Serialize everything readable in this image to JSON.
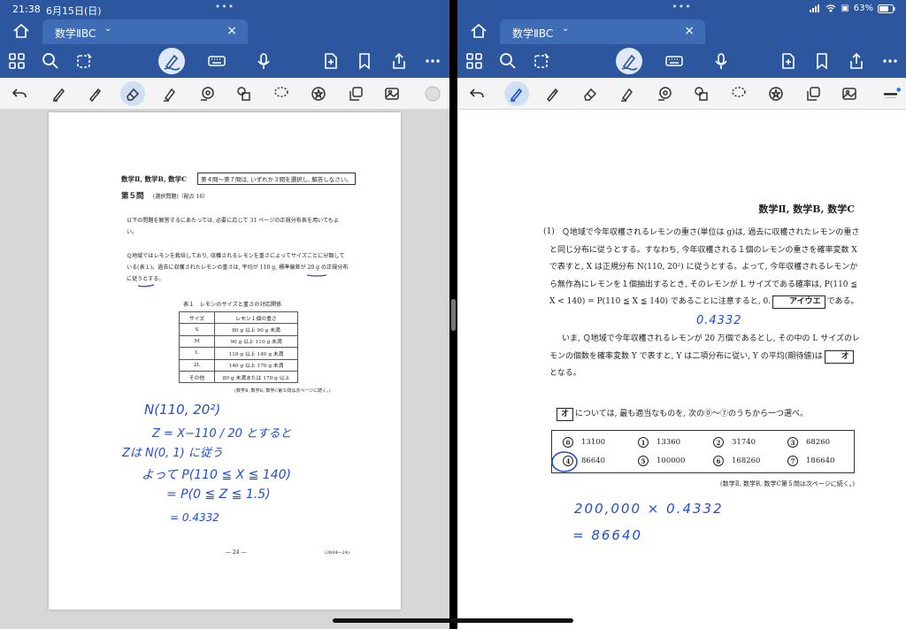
{
  "status": {
    "time": "21:38",
    "date": "6月15日(日)",
    "battery": "63%"
  },
  "tab": {
    "title": "数学ⅡBC"
  },
  "left_page": {
    "header": "数学Ⅱ, 数学B, 数学C",
    "header_box": "第４問～第７問は, いずれか３問を選択し, 解答しなさい。",
    "question_title": "第５問",
    "question_sub": "(選択問題)（配点 16）",
    "intro": "以下の問題を解答するにあたっては, 必要に応じて 31 ページの正規分布表を用いてもよい。",
    "body": "Ｑ地域ではレモンを栽培しており, 収穫されるレモンを重さによってサイズごとに分類している(表１)。過去に収穫されたレモンの重さは, 平均が 110 g, 標準偏差が 20 g の正規分布に従うとする。",
    "table_caption": "表１　レモンのサイズと重さの対応関係",
    "table": {
      "headers": [
        "サイズ",
        "レモン１個の重さ"
      ],
      "rows": [
        [
          "S",
          "80 g 以上 90 g 未満"
        ],
        [
          "M",
          "90 g 以上 110 g 未満"
        ],
        [
          "L",
          "110 g 以上 140 g 未満"
        ],
        [
          "2L",
          "140 g 以上 170 g 未満"
        ],
        [
          "その他",
          "80 g 未満または 170 g 以上"
        ]
      ]
    },
    "continued": "(数学Ⅱ, 数学B, 数学C第５問は次ページに続く。)",
    "page_number": "― 24 ―",
    "code": "(2604―24)"
  },
  "right_page": {
    "header": "数学Ⅱ, 数学B, 数学C",
    "q_number": "(1)",
    "para1a": "Ｑ地域で今年収穫されるレモンの重さ(単位は g)は, 過去に収穫されたレモンの重さと同じ分布に従うとする。すなわち, 今年収穫される１個のレモンの重さを確率変数 X で表すと, X は正規分布 N(110, 20²) に従うとする。よって, 今年収穫されるレモンから無作為にレモンを１個抽出するとき, そのレモンが L サイズである確率は, P(110 ≦ X < 140) = P(110 ≦ X ≦ 140) であることに注意すると, 0.",
    "box1": "アイウエ",
    "para1b": "である。",
    "para2a": "いま, Ｑ地域で今年収穫されるレモンが 20 万個であるとし, その中の L サイズのレモンの個数を確率変数 Y で表すと, Y は二項分布に従い, Y の平均(期待値)は",
    "box2": "オ",
    "para2b": "となる。",
    "choice_box": "オ",
    "choice_lead": "については, 最も適当なものを, 次の⓪～⑦のうちから一つ選べ。",
    "choices": [
      {
        "mark": "0",
        "value": "13100"
      },
      {
        "mark": "1",
        "value": "13360"
      },
      {
        "mark": "2",
        "value": "31740"
      },
      {
        "mark": "3",
        "value": "68260"
      },
      {
        "mark": "4",
        "value": "86640"
      },
      {
        "mark": "5",
        "value": "100000"
      },
      {
        "mark": "6",
        "value": "168260"
      },
      {
        "mark": "7",
        "value": "186640"
      }
    ],
    "continued": "(数学Ⅱ, 数学B, 数学C第５問は次ページに続く。)"
  },
  "handwriting": {
    "left": [
      "N(110, 20²)",
      "Z = X−110 / 20 とすると",
      "Zは N(0, 1) に従う",
      "よって P(110 ≦ X ≦ 140)",
      "= P(0 ≦ Z ≦ 1.5)",
      "= 0.4332"
    ],
    "right": [
      "0.4332",
      "200,000 × 0.4332",
      "= 86640"
    ]
  },
  "colors": {
    "toolbar": "#2c579e",
    "tab_active": "#3f6db5",
    "ink": "#1f4fd6"
  }
}
